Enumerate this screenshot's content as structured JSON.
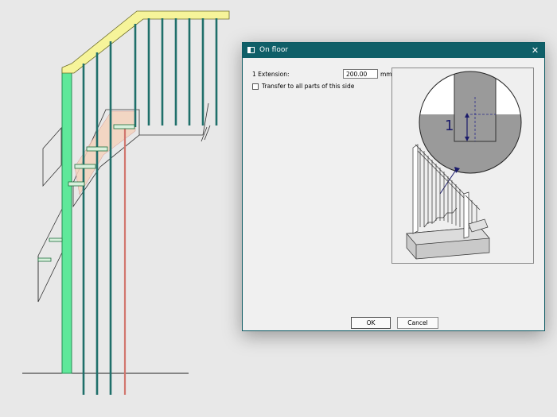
{
  "dialog": {
    "title": "On floor",
    "extension_label": "1 Extension:",
    "extension_value": "200.00",
    "extension_unit": "mm",
    "transfer_label": "Transfer to all parts of this side",
    "transfer_checked": false,
    "ok_label": "OK",
    "cancel_label": "Cancel",
    "close_glyph": "✕",
    "preview_callout": "1"
  },
  "icons": {
    "title": "window-icon",
    "close": "close-icon"
  },
  "colors": {
    "titlebar": "#0f5f68",
    "post_green": "#5fe89a",
    "handrail_yellow": "#f6f49a",
    "baluster_teal": "#1f6f6a",
    "red_baluster": "#d1766e"
  }
}
